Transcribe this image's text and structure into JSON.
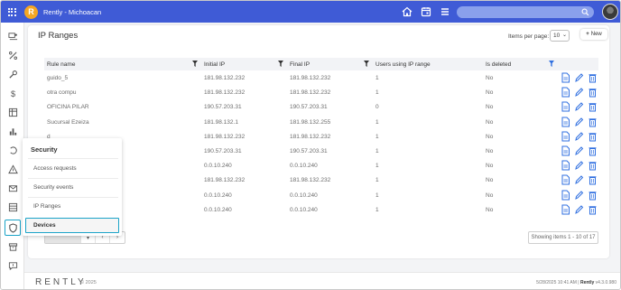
{
  "header": {
    "logo_letter": "R",
    "app_title": "Rently - Michoacan",
    "search": {
      "placeholder": ""
    }
  },
  "page": {
    "title": "IP Ranges",
    "items_per_page_label": "Items per page:",
    "items_per_page_value": "10",
    "new_button_label": "New"
  },
  "table": {
    "columns": [
      "Rule name",
      "Initial IP",
      "Final IP",
      "Users using IP range",
      "Is deleted"
    ],
    "rows": [
      {
        "rule_name": "guido_5",
        "initial_ip": "181.98.132.232",
        "final_ip": "181.98.132.232",
        "users": "1",
        "is_deleted": "No"
      },
      {
        "rule_name": "otra compu",
        "initial_ip": "181.98.132.232",
        "final_ip": "181.98.132.232",
        "users": "1",
        "is_deleted": "No"
      },
      {
        "rule_name": "OFICINA PILAR",
        "initial_ip": "190.57.203.31",
        "final_ip": "190.57.203.31",
        "users": "0",
        "is_deleted": "No"
      },
      {
        "rule_name": "Sucursal Ezeiza",
        "initial_ip": "181.98.132.1",
        "final_ip": "181.98.132.255",
        "users": "1",
        "is_deleted": "No"
      },
      {
        "rule_name": "d",
        "initial_ip": "181.98.132.232",
        "final_ip": "181.98.132.232",
        "users": "1",
        "is_deleted": "No"
      },
      {
        "rule_name": "",
        "initial_ip": "190.57.203.31",
        "final_ip": "190.57.203.31",
        "users": "1",
        "is_deleted": "No"
      },
      {
        "rule_name": "",
        "initial_ip": "0.0.10.240",
        "final_ip": "0.0.10.240",
        "users": "1",
        "is_deleted": "No"
      },
      {
        "rule_name": "",
        "initial_ip": "181.98.132.232",
        "final_ip": "181.98.132.232",
        "users": "1",
        "is_deleted": "No"
      },
      {
        "rule_name": "",
        "initial_ip": "0.0.10.240",
        "final_ip": "0.0.10.240",
        "users": "1",
        "is_deleted": "No"
      },
      {
        "rule_name": "",
        "initial_ip": "0.0.10.240",
        "final_ip": "0.0.10.240",
        "users": "1",
        "is_deleted": "No"
      }
    ],
    "row_action_icons": [
      "document-icon",
      "pencil-icon",
      "trash-icon"
    ]
  },
  "pagination": {
    "buttons": [
      "",
      "▾",
      "‹",
      "›"
    ],
    "showing_text": "Showing items 1 - 10 of 17"
  },
  "security_menu": {
    "title": "Security",
    "items": [
      "Access requests",
      "Security events",
      "IP Ranges"
    ],
    "active_item": "Devices"
  },
  "footer": {
    "brand": "RENTLY",
    "copyright": "© 2025",
    "timestamp": "5/28/2025 10:41 AM",
    "separator": " | ",
    "brand_short": "Rently",
    "version": " v4.3.0.980"
  },
  "colors": {
    "topbar": "#3f5bd6",
    "accent": "#1aa3c7",
    "action_icons": "#2f6fe0",
    "logo": "#f5a623"
  }
}
